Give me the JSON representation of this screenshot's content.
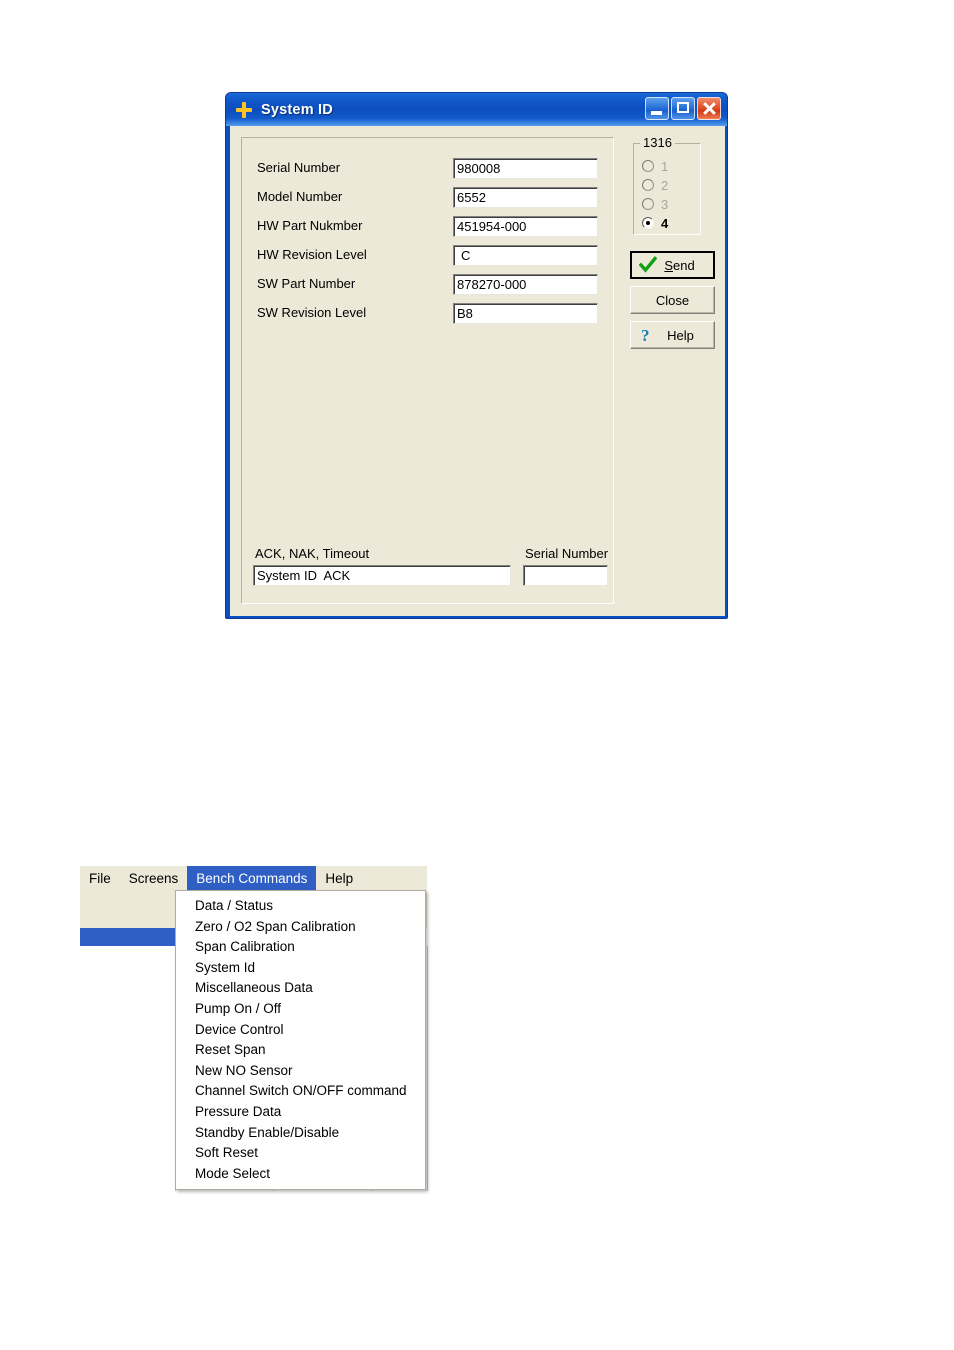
{
  "dialog": {
    "title": "System ID",
    "title_icon": "yellow-cross-icon",
    "window_controls": [
      {
        "name": "minimize-button",
        "glyph": "minimize-icon"
      },
      {
        "name": "maximize-button",
        "glyph": "maximize-icon"
      },
      {
        "name": "close-button",
        "glyph": "close-icon"
      }
    ],
    "fields": [
      {
        "label": "Serial Number",
        "value": "980008"
      },
      {
        "label": "Model Number",
        "value": "6552"
      },
      {
        "label": "HW Part Nukmber",
        "value": "451954-000"
      },
      {
        "label": "HW Revision Level",
        "value": "C"
      },
      {
        "label": "SW Part Number",
        "value": "878270-000"
      },
      {
        "label": "SW Revision Level",
        "value": "B8"
      }
    ],
    "status": {
      "label": "ACK, NAK, Timeout",
      "value": "System ID  ACK",
      "serial_label": "Serial Number",
      "serial_value": ""
    },
    "radio_group": {
      "title": "1316",
      "options": [
        {
          "label": "1",
          "selected": false,
          "enabled": false
        },
        {
          "label": "2",
          "selected": false,
          "enabled": false
        },
        {
          "label": "3",
          "selected": false,
          "enabled": false
        },
        {
          "label": "4",
          "selected": true,
          "enabled": true
        }
      ]
    },
    "buttons": [
      {
        "name": "send-button",
        "label": "Send",
        "icon": "green-check-icon",
        "default": true
      },
      {
        "name": "close-button",
        "label": "Close",
        "icon": "",
        "default": false
      },
      {
        "name": "help-button",
        "label": "Help",
        "icon": "question-mark-icon",
        "default": false
      }
    ]
  },
  "menu": {
    "bar": [
      {
        "label": "File",
        "active": false
      },
      {
        "label": "Screens",
        "active": false
      },
      {
        "label": "Bench Commands",
        "active": true
      },
      {
        "label": "Help",
        "active": false
      }
    ],
    "dropdown_items": [
      "Data / Status",
      "Zero / O2 Span Calibration",
      "Span Calibration",
      "System Id",
      "Miscellaneous Data",
      "Pump On / Off",
      "Device Control",
      "Reset Span",
      "New NO Sensor",
      "Channel Switch ON/OFF command",
      "Pressure Data",
      "Standby Enable/Disable",
      "Soft Reset",
      "Mode Select"
    ]
  },
  "colors": {
    "title_blue": "#0c4ec0",
    "menu_highlight": "#2f5fc4",
    "dialog_face": "#ece9d8",
    "check_green": "#16a016",
    "help_teal": "#1a7fb5",
    "icon_yellow": "#ffc324"
  }
}
